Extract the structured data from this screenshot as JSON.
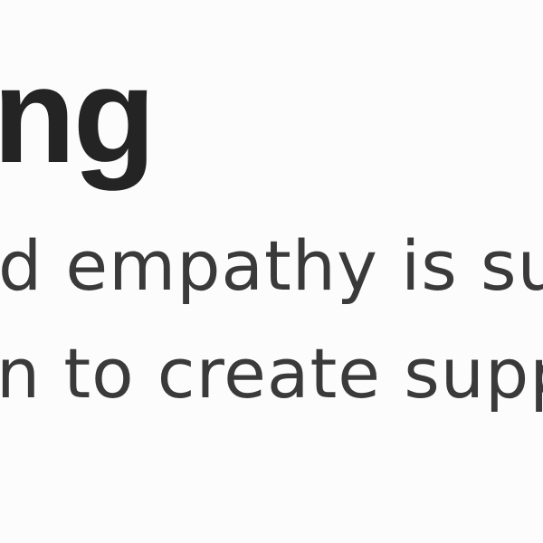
{
  "content": {
    "heading_fragment": "ng",
    "body_lines": [
      "d empathy is sup",
      "n to create supp"
    ]
  }
}
